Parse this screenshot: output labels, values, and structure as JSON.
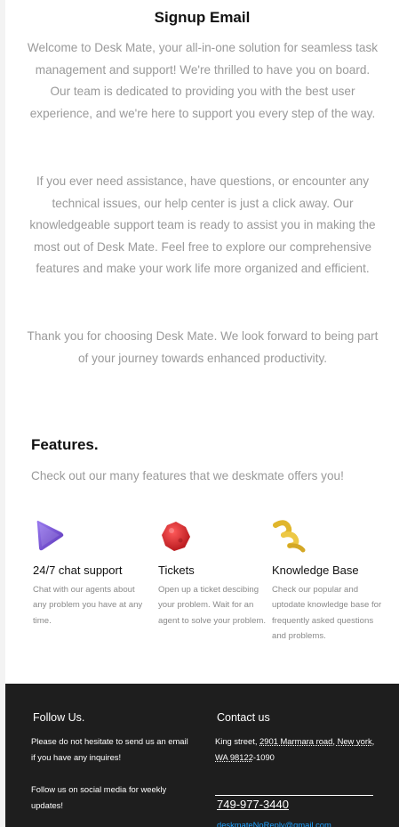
{
  "email": {
    "title": "Signup Email",
    "paragraphs": [
      "Welcome to Desk Mate, your all-in-one solution for seamless task management and support! We're thrilled to have you on board. Our team is dedicated to providing you with the best user experience, and we're here to support you every step of the way.",
      "If you ever need assistance, have questions, or encounter any technical issues, our help center is just a click away. Our knowledgeable support team is ready to assist you in making the most out of Desk Mate. Feel free to explore our comprehensive features and make your work life more organized and efficient.",
      "Thank you for choosing Desk Mate. We look forward to being part of your journey towards enhanced productivity."
    ]
  },
  "features": {
    "title": "Features.",
    "subtitle": "Check out our many features that we deskmate offers you!",
    "items": [
      {
        "name": "24/7 chat support",
        "description": "Chat with our agents about any problem you have at any time.",
        "icon": "purple-cone-icon",
        "color": "#7b52d9"
      },
      {
        "name": "Tickets",
        "description": "Open up a ticket descibing your problem. Wait for an agent to solve your problem.",
        "icon": "red-blob-icon",
        "color": "#e0282c"
      },
      {
        "name": "Knowledge Base",
        "description": "Check our popular and uptodate knowledge base for frequently asked questions and problems.",
        "icon": "yellow-twist-icon",
        "color": "#e9c23a"
      }
    ]
  },
  "footer": {
    "follow_title": "Follow Us.",
    "follow_text_1": "Please do not hesitate to send us an email if you have any inquires!",
    "follow_text_2": "Follow us on social media for weekly updates!",
    "contact_title": "Contact us",
    "address_prefix": "King street, ",
    "address_link": "2901 Marmara road, New york, WA 98122",
    "address_suffix": "-1090",
    "phone": "749-977-3440",
    "email": "deskmateNoReply@gmail.com"
  }
}
